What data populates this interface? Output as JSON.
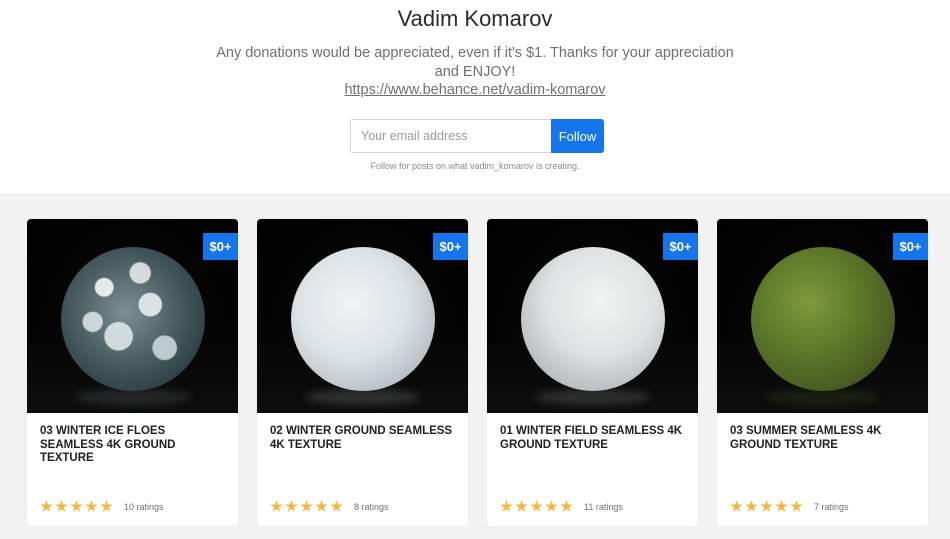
{
  "header": {
    "creator_name": "Vadim Komarov",
    "description": "Any donations would be appreciated, even if it's $1. Thanks for your appreciation and ENJOY!",
    "profile_link": "https://www.behance.net/vadim-komarov",
    "email_placeholder": "Your email address",
    "email_value": "",
    "follow_label": "Follow",
    "follow_hint": "Follow for posts on what vadim_komarov is creating."
  },
  "products": [
    {
      "title": "03 WINTER ICE FLOES SEAMLESS 4K GROUND TEXTURE",
      "price": "$0+",
      "stars": 5,
      "ratings": "10 ratings",
      "thumbnail": "ice-floes-sphere"
    },
    {
      "title": "02 WINTER GROUND SEAMLESS 4K TEXTURE",
      "price": "$0+",
      "stars": 5,
      "ratings": "8 ratings",
      "thumbnail": "snow-ground-sphere"
    },
    {
      "title": "01 WINTER FIELD SEAMLESS 4K GROUND TEXTURE",
      "price": "$0+",
      "stars": 5,
      "ratings": "11 ratings",
      "thumbnail": "snow-field-sphere"
    },
    {
      "title": "03 SUMMER SEAMLESS 4K GROUND TEXTURE",
      "price": "$0+",
      "stars": 5,
      "ratings": "7 ratings",
      "thumbnail": "grass-sphere"
    }
  ],
  "colors": {
    "accent": "#1475ec",
    "star": "#f6b740",
    "grid_background": "#f2f2f2"
  }
}
